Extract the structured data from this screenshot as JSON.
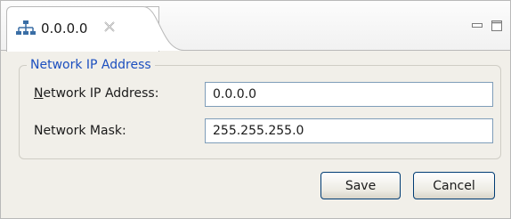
{
  "tab": {
    "title": "0.0.0.0",
    "icon": "network-icon",
    "close_icon": "close-icon"
  },
  "window_controls": {
    "minimize_icon": "minimize-icon",
    "maximize_icon": "maximize-icon"
  },
  "group": {
    "title": "Network IP Address"
  },
  "form": {
    "ip_label_underlined": "N",
    "ip_label_rest": "etwork IP Address:",
    "ip_value": "0.0.0.0",
    "mask_label": "Network Mask:",
    "mask_value": "255.255.255.0"
  },
  "buttons": {
    "save": "Save",
    "cancel": "Cancel"
  },
  "colors": {
    "accent_title": "#1c4fbf",
    "field_border": "#7f9db9",
    "button_border": "#003c74"
  }
}
